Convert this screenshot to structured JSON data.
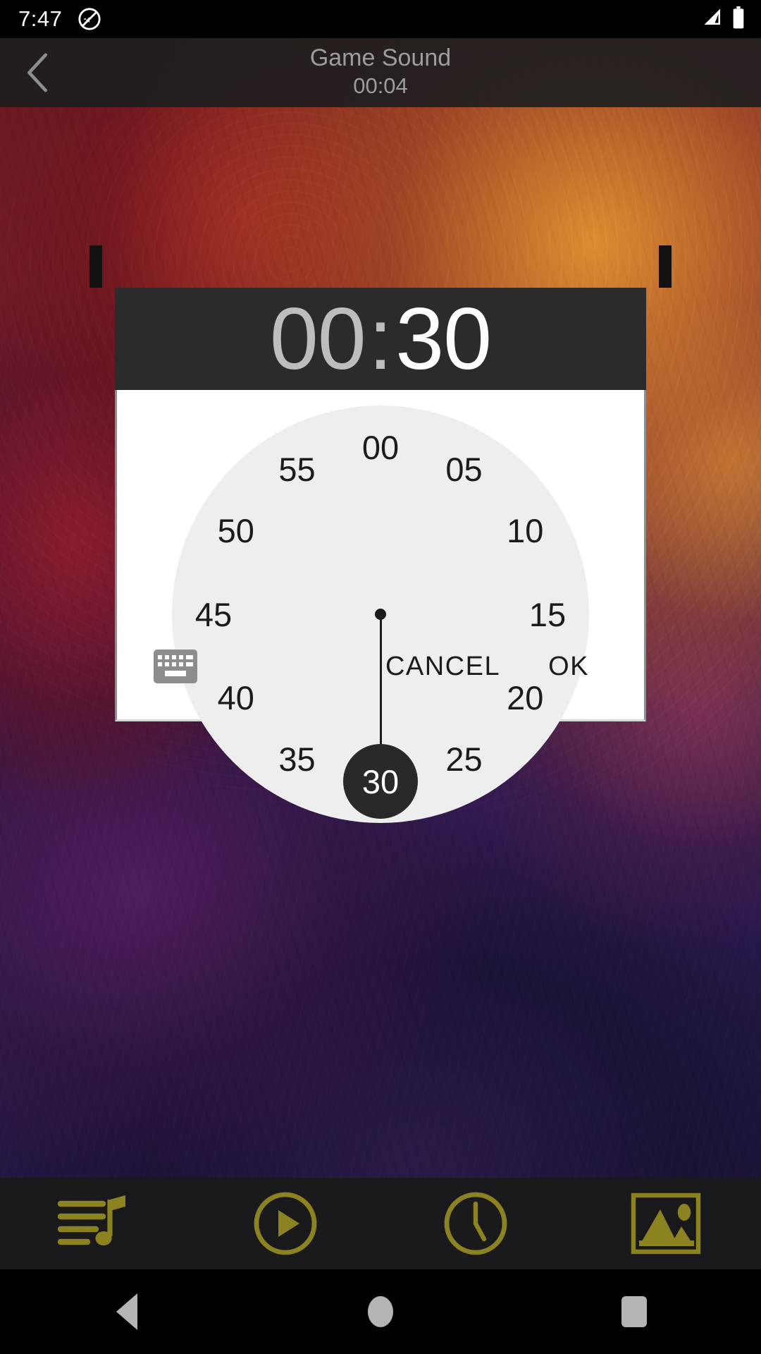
{
  "status_bar": {
    "time": "7:47",
    "icons": [
      "do-not-disturb-icon",
      "signal-icon",
      "battery-icon"
    ]
  },
  "app_bar": {
    "back_icon": "back-chevron-icon",
    "title": "Game Sound",
    "subtitle": "00:04"
  },
  "dialog": {
    "header": {
      "hours": "00",
      "separator": ":",
      "minutes": "30",
      "hours_color": "#bdbdbd",
      "minutes_color": "#ffffff",
      "background": "#2b2b2b"
    },
    "clock": {
      "mode": "minutes",
      "selected_value": "30",
      "selected_angle_deg": 180,
      "face_background": "#eeeeee",
      "hand_color": "#1b1b1b",
      "knob_background": "#292929",
      "knob_text_color": "#ffffff",
      "ticks": [
        {
          "label": "00",
          "angle": 0
        },
        {
          "label": "05",
          "angle": 30
        },
        {
          "label": "10",
          "angle": 60
        },
        {
          "label": "15",
          "angle": 90
        },
        {
          "label": "20",
          "angle": 120
        },
        {
          "label": "25",
          "angle": 150
        },
        {
          "label": "30",
          "angle": 180
        },
        {
          "label": "35",
          "angle": 210
        },
        {
          "label": "40",
          "angle": 240
        },
        {
          "label": "45",
          "angle": 270
        },
        {
          "label": "50",
          "angle": 300
        },
        {
          "label": "55",
          "angle": 330
        }
      ]
    },
    "actions": {
      "keyboard_icon": "keyboard-icon",
      "cancel_label": "CANCEL",
      "ok_label": "OK"
    }
  },
  "toolbar": {
    "accent_color": "#8c8220",
    "items": [
      {
        "name": "playlist-music-icon",
        "label": "Playlist"
      },
      {
        "name": "play-circle-icon",
        "label": "Play"
      },
      {
        "name": "clock-icon",
        "label": "Timer"
      },
      {
        "name": "image-icon",
        "label": "Background"
      }
    ]
  },
  "nav_bar": {
    "items": [
      {
        "name": "nav-back-icon",
        "label": "Back"
      },
      {
        "name": "nav-home-icon",
        "label": "Home"
      },
      {
        "name": "nav-recents-icon",
        "label": "Recents"
      }
    ]
  }
}
